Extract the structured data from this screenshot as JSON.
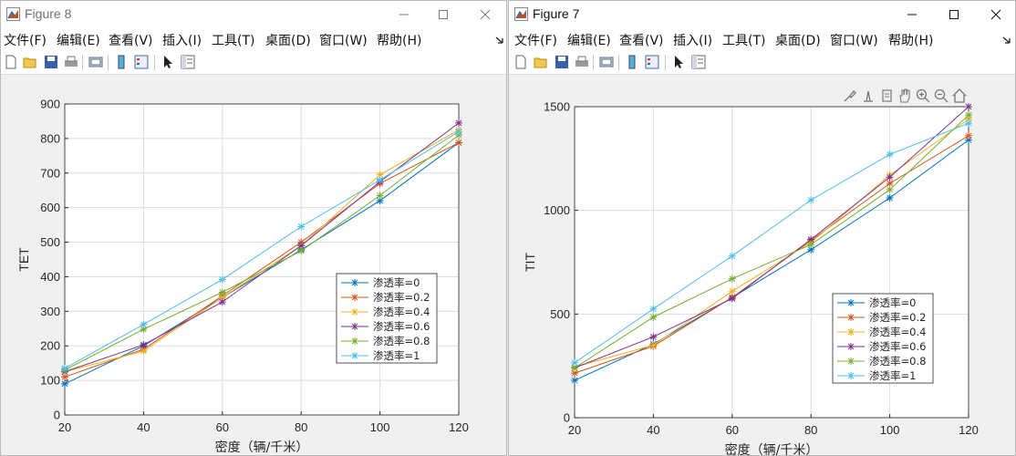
{
  "windows": [
    {
      "id": "fig8",
      "title": "Figure 8",
      "menu": [
        "文件(F)",
        "编辑(E)",
        "查看(V)",
        "插入(I)",
        "工具(T)",
        "桌面(D)",
        "窗口(W)",
        "帮助(H)"
      ]
    },
    {
      "id": "fig7",
      "title": "Figure 7",
      "menu": [
        "文件(F)",
        "编辑(E)",
        "查看(V)",
        "插入(I)",
        "工具(T)",
        "桌面(D)",
        "窗口(W)",
        "帮助(H)"
      ]
    }
  ],
  "colors": {
    "series": [
      "#0072BD",
      "#D95319",
      "#EDB120",
      "#7E2F8E",
      "#77AC30",
      "#4DBEEE"
    ],
    "grid": "#dcdcdc",
    "axis": "#262626"
  },
  "chart_data": [
    {
      "type": "line",
      "figure": "Figure 8",
      "x": [
        20,
        40,
        60,
        80,
        100,
        120
      ],
      "xlim": [
        20,
        120
      ],
      "ylim": [
        0,
        900
      ],
      "xticks": [
        20,
        40,
        60,
        80,
        100,
        120
      ],
      "yticks": [
        0,
        100,
        200,
        300,
        400,
        500,
        600,
        700,
        800,
        900
      ],
      "xlabel": "密度（辆/千米）",
      "ylabel": "TET",
      "marker": "asterisk",
      "grid": true,
      "legend_position": "lower-right",
      "series": [
        {
          "name": "渗透率=0",
          "values": [
            90,
            200,
            340,
            478,
            620,
            788
          ]
        },
        {
          "name": "渗透率=0.2",
          "values": [
            110,
            190,
            345,
            500,
            670,
            788
          ]
        },
        {
          "name": "渗透率=0.4",
          "values": [
            125,
            185,
            340,
            490,
            695,
            825
          ]
        },
        {
          "name": "渗透率=0.6",
          "values": [
            125,
            203,
            327,
            490,
            675,
            845
          ]
        },
        {
          "name": "渗透率=0.8",
          "values": [
            130,
            248,
            355,
            475,
            635,
            810
          ]
        },
        {
          "name": "渗透率=1",
          "values": [
            135,
            262,
            392,
            545,
            680,
            820
          ]
        }
      ]
    },
    {
      "type": "line",
      "figure": "Figure 7",
      "x": [
        20,
        40,
        60,
        80,
        100,
        120
      ],
      "xlim": [
        20,
        120
      ],
      "ylim": [
        0,
        1500
      ],
      "xticks": [
        20,
        40,
        60,
        80,
        100,
        120
      ],
      "yticks": [
        0,
        500,
        1000,
        1500
      ],
      "xlabel": "密度（辆/千米）",
      "ylabel": "TIT",
      "marker": "asterisk",
      "grid": true,
      "legend_position": "lower-right",
      "series": [
        {
          "name": "渗透率=0",
          "values": [
            180,
            355,
            580,
            810,
            1060,
            1340
          ]
        },
        {
          "name": "渗透率=0.2",
          "values": [
            215,
            345,
            580,
            855,
            1130,
            1360
          ]
        },
        {
          "name": "渗透率=0.4",
          "values": [
            245,
            350,
            610,
            845,
            1170,
            1440
          ]
        },
        {
          "name": "渗透率=0.6",
          "values": [
            240,
            390,
            575,
            860,
            1160,
            1500
          ]
        },
        {
          "name": "渗透率=0.8",
          "values": [
            240,
            485,
            670,
            835,
            1100,
            1460
          ]
        },
        {
          "name": "渗透率=1",
          "values": [
            265,
            525,
            780,
            1050,
            1270,
            1420
          ]
        }
      ]
    }
  ]
}
